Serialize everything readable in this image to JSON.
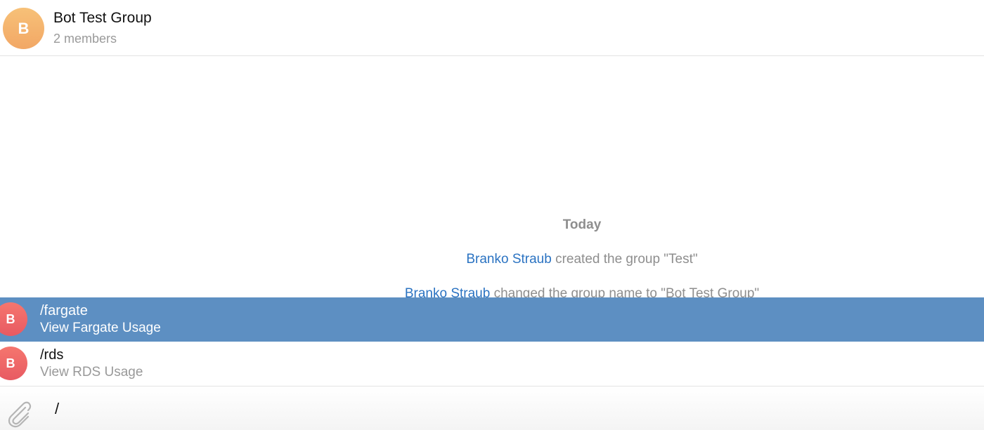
{
  "chat": {
    "avatar_letter": "B",
    "title": "Bot Test Group",
    "subtitle": "2 members"
  },
  "messages": {
    "date_separator": "Today",
    "service": [
      {
        "actor": "Branko Straub",
        "text": " created the group \"Test\""
      },
      {
        "actor": "Branko Straub",
        "text": " changed the group name to \"Bot Test Group\""
      }
    ]
  },
  "commands": [
    {
      "avatar_letter": "B",
      "command": "/fargate",
      "description": "View Fargate Usage",
      "selected": true
    },
    {
      "avatar_letter": "B",
      "command": "/rds",
      "description": "View RDS Usage",
      "selected": false
    }
  ],
  "composer": {
    "value": "/",
    "attach_icon": "paperclip-icon"
  },
  "colors": {
    "accent": "#2b73c2",
    "selection": "#5d8fc2",
    "group_avatar": "#f2a765",
    "bot_avatar": "#e85a62"
  }
}
